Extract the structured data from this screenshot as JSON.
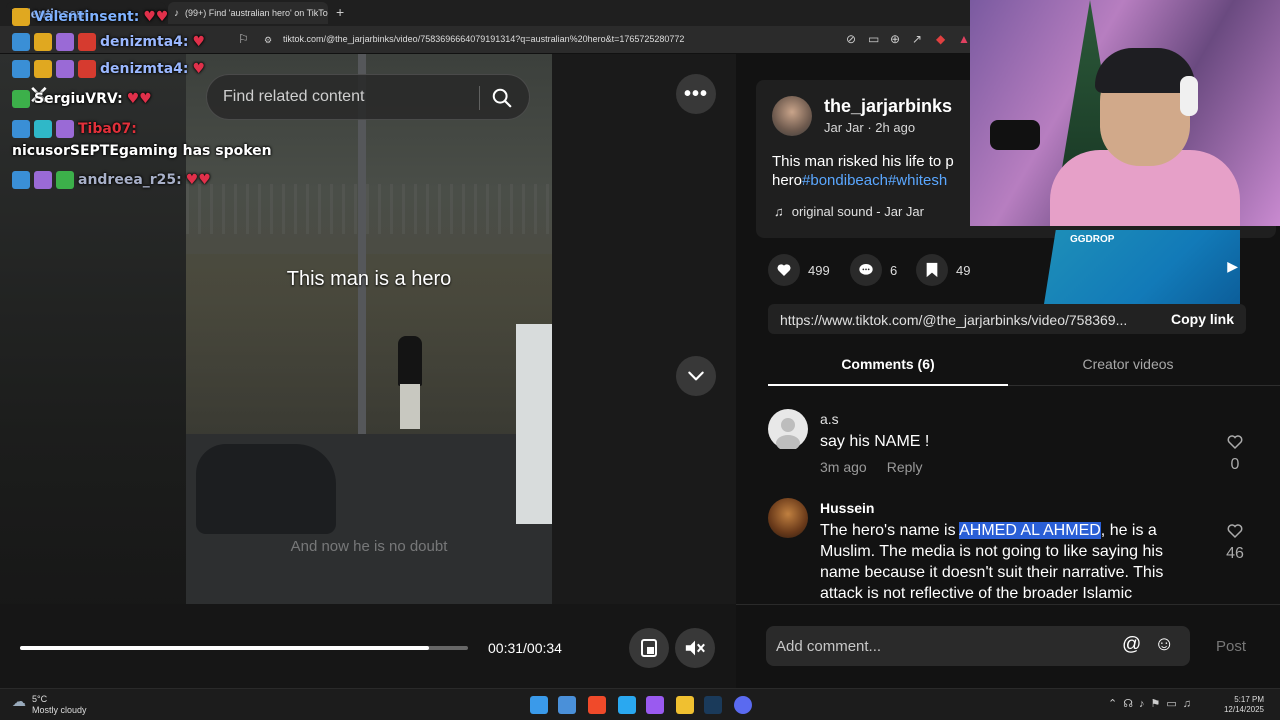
{
  "browser": {
    "tabs": [
      {
        "label": "Valentinsent"
      },
      {
        "label": "(99+) Find 'australian hero' on TikTok"
      }
    ],
    "new_tab": "+",
    "url": "tiktok.com/@the_jarjarbinks/video/7583696664079191314?q=australian%20hero&t=1765725280772"
  },
  "chat": {
    "messages": [
      {
        "user": "Valentinsent:",
        "color": "#7fb2ff"
      },
      {
        "user": "denizmta4:",
        "color": "#9bb8ff"
      },
      {
        "user": "denizmta4:",
        "color": "#9bb8ff"
      },
      {
        "user": "SergiuVRV:",
        "color": "#ffffff"
      },
      {
        "user": "Tiba07:",
        "color": "#e0303a"
      },
      {
        "user": "nicusorSEPTEgaming has spoken",
        "color": "#ffffff"
      },
      {
        "user": "andreea_r25:",
        "color": "#a8b0c8"
      }
    ]
  },
  "search": {
    "placeholder": "Find related content"
  },
  "video": {
    "caption": "This man is a hero",
    "subtitle": "And now he is no doubt",
    "time": "00:31/00:34",
    "progress": 0.912
  },
  "post": {
    "username": "the_jarjarbinks",
    "subname": "Jar Jar · 2h ago",
    "desc_text": "This man risked his life to p",
    "desc_text2": "hero",
    "hashtag1": "#bondibeach",
    "hashtag2": "#whitesh",
    "sound": "original sound - Jar Jar"
  },
  "stats": {
    "likes": "499",
    "comments": "6",
    "saves": "49"
  },
  "share": {
    "url": "https://www.tiktok.com/@the_jarjarbinks/video/758369...",
    "copy_label": "Copy link"
  },
  "tabs": {
    "comments": "Comments (6)",
    "creator": "Creator videos"
  },
  "comments": [
    {
      "user": "a.s",
      "text": "say his NAME !",
      "time": "3m ago",
      "reply": "Reply",
      "likes": "0"
    },
    {
      "user": "Hussein",
      "text_before": "The hero's name is ",
      "highlight": "AHMED AL AHMED",
      "text_after": ", he is a Muslim. The media is not going to like saying his name because it doesn't suit their narrative. This attack is not reflective of the broader Islamic",
      "likes": "46"
    }
  ],
  "add_comment": {
    "placeholder": "Add comment...",
    "post": "Post"
  },
  "overlay": {
    "ggdrop": "GGDROP"
  },
  "taskbar": {
    "temp": "5°C",
    "condition": "Mostly cloudy",
    "time": "5:17 PM",
    "date": "12/14/2025"
  }
}
